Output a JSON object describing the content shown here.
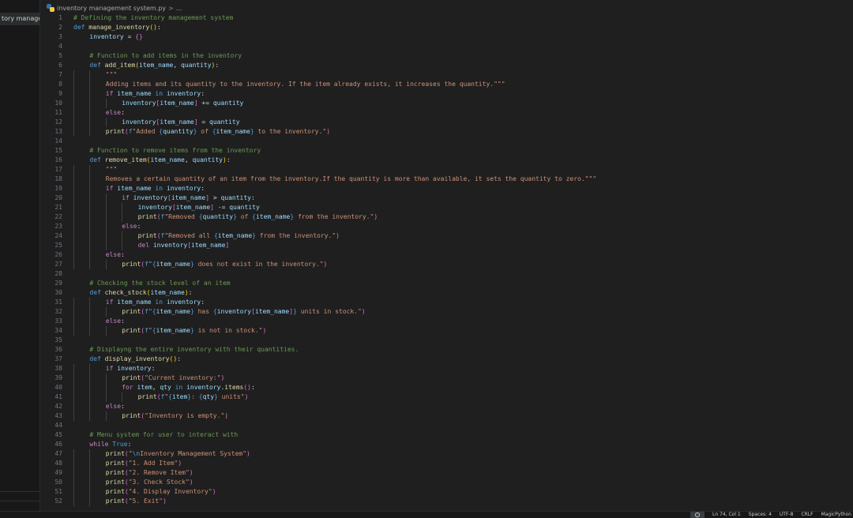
{
  "explorer": {
    "open_item": "tory manage..."
  },
  "tab": {
    "file_name": "inventory management system.py",
    "chevron": ">",
    "ellipsis": "..."
  },
  "status_bar": {
    "line_col": "Ln 74, Col 1",
    "spaces": "Spaces: 4",
    "encoding": "UTF-8",
    "eol": "CRLF",
    "language": "MagicPython"
  },
  "code": [
    {
      "n": "1",
      "i": 0,
      "t": [
        [
          "cm",
          "# Defining the inventory management system"
        ]
      ]
    },
    {
      "n": "2",
      "i": 0,
      "t": [
        [
          "kw",
          "def "
        ],
        [
          "fn",
          "manage_inventory"
        ],
        [
          "br",
          "()"
        ],
        [
          "op",
          ":"
        ]
      ]
    },
    {
      "n": "3",
      "i": 1,
      "t": [
        [
          "var",
          "inventory"
        ],
        [
          "op",
          " = "
        ],
        [
          "br2",
          "{}"
        ]
      ]
    },
    {
      "n": "4",
      "i": 0,
      "t": []
    },
    {
      "n": "5",
      "i": 1,
      "t": [
        [
          "cm",
          "# Function to add items in the inventory"
        ]
      ]
    },
    {
      "n": "6",
      "i": 1,
      "t": [
        [
          "kw",
          "def "
        ],
        [
          "fn",
          "add_item"
        ],
        [
          "br",
          "("
        ],
        [
          "var",
          "item_name"
        ],
        [
          "op",
          ", "
        ],
        [
          "var",
          "quantity"
        ],
        [
          "br",
          ")"
        ],
        [
          "op",
          ":"
        ]
      ]
    },
    {
      "n": "7",
      "i": 2,
      "t": [
        [
          "str",
          "\"\"\""
        ]
      ]
    },
    {
      "n": "8",
      "i": 2,
      "t": [
        [
          "str",
          "Adding items and its quantity to the inventory. If the item already exists, it increases the quantity.\"\"\""
        ]
      ]
    },
    {
      "n": "9",
      "i": 2,
      "t": [
        [
          "ctl",
          "if "
        ],
        [
          "var",
          "item_name"
        ],
        [
          "kw",
          " in "
        ],
        [
          "var",
          "inventory"
        ],
        [
          "op",
          ":"
        ]
      ]
    },
    {
      "n": "10",
      "i": 3,
      "t": [
        [
          "var",
          "inventory"
        ],
        [
          "br2",
          "["
        ],
        [
          "var",
          "item_name"
        ],
        [
          "br2",
          "]"
        ],
        [
          "op",
          " += "
        ],
        [
          "var",
          "quantity"
        ]
      ]
    },
    {
      "n": "11",
      "i": 2,
      "t": [
        [
          "ctl",
          "else"
        ],
        [
          "op",
          ":"
        ]
      ]
    },
    {
      "n": "12",
      "i": 3,
      "t": [
        [
          "var",
          "inventory"
        ],
        [
          "br2",
          "["
        ],
        [
          "var",
          "item_name"
        ],
        [
          "br2",
          "]"
        ],
        [
          "op",
          " = "
        ],
        [
          "var",
          "quantity"
        ]
      ]
    },
    {
      "n": "13",
      "i": 2,
      "t": [
        [
          "fn",
          "print"
        ],
        [
          "br2",
          "("
        ],
        [
          "kw",
          "f"
        ],
        [
          "str",
          "\"Added "
        ],
        [
          "kw",
          "{"
        ],
        [
          "var",
          "quantity"
        ],
        [
          "kw",
          "}"
        ],
        [
          "str",
          " of "
        ],
        [
          "kw",
          "{"
        ],
        [
          "var",
          "item_name"
        ],
        [
          "kw",
          "}"
        ],
        [
          "str",
          " to the inventory.\""
        ],
        [
          "br2",
          ")"
        ]
      ]
    },
    {
      "n": "14",
      "i": 0,
      "t": []
    },
    {
      "n": "15",
      "i": 1,
      "t": [
        [
          "cm",
          "# Function to remove items from the inventory"
        ]
      ]
    },
    {
      "n": "16",
      "i": 1,
      "t": [
        [
          "kw",
          "def "
        ],
        [
          "fn",
          "remove_item"
        ],
        [
          "br",
          "("
        ],
        [
          "var",
          "item_name"
        ],
        [
          "op",
          ", "
        ],
        [
          "var",
          "quantity"
        ],
        [
          "br",
          ")"
        ],
        [
          "op",
          ":"
        ]
      ]
    },
    {
      "n": "17",
      "i": 2,
      "t": [
        [
          "str",
          "\"\"\""
        ]
      ]
    },
    {
      "n": "18",
      "i": 2,
      "t": [
        [
          "str",
          "Removes a certain quantity of an item from the inventory.If the quantity is more than available, it sets the quantity to zero.\"\"\""
        ]
      ]
    },
    {
      "n": "19",
      "i": 2,
      "t": [
        [
          "ctl",
          "if "
        ],
        [
          "var",
          "item_name"
        ],
        [
          "kw",
          " in "
        ],
        [
          "var",
          "inventory"
        ],
        [
          "op",
          ":"
        ]
      ]
    },
    {
      "n": "20",
      "i": 3,
      "t": [
        [
          "ctl",
          "if "
        ],
        [
          "var",
          "inventory"
        ],
        [
          "br2",
          "["
        ],
        [
          "var",
          "item_name"
        ],
        [
          "br2",
          "]"
        ],
        [
          "op",
          " > "
        ],
        [
          "var",
          "quantity"
        ],
        [
          "op",
          ":"
        ]
      ]
    },
    {
      "n": "21",
      "i": 4,
      "t": [
        [
          "var",
          "inventory"
        ],
        [
          "br2",
          "["
        ],
        [
          "var",
          "item_name"
        ],
        [
          "br2",
          "]"
        ],
        [
          "op",
          " -= "
        ],
        [
          "var",
          "quantity"
        ]
      ]
    },
    {
      "n": "22",
      "i": 4,
      "t": [
        [
          "fn",
          "print"
        ],
        [
          "br2",
          "("
        ],
        [
          "kw",
          "f"
        ],
        [
          "str",
          "\"Removed "
        ],
        [
          "kw",
          "{"
        ],
        [
          "var",
          "quantity"
        ],
        [
          "kw",
          "}"
        ],
        [
          "str",
          " of "
        ],
        [
          "kw",
          "{"
        ],
        [
          "var",
          "item_name"
        ],
        [
          "kw",
          "}"
        ],
        [
          "str",
          " from the inventory.\""
        ],
        [
          "br2",
          ")"
        ]
      ]
    },
    {
      "n": "23",
      "i": 3,
      "t": [
        [
          "ctl",
          "else"
        ],
        [
          "op",
          ":"
        ]
      ]
    },
    {
      "n": "24",
      "i": 4,
      "t": [
        [
          "fn",
          "print"
        ],
        [
          "br2",
          "("
        ],
        [
          "kw",
          "f"
        ],
        [
          "str",
          "\"Removed all "
        ],
        [
          "kw",
          "{"
        ],
        [
          "var",
          "item_name"
        ],
        [
          "kw",
          "}"
        ],
        [
          "str",
          " from the inventory.\""
        ],
        [
          "br2",
          ")"
        ]
      ]
    },
    {
      "n": "25",
      "i": 4,
      "t": [
        [
          "ctl",
          "del "
        ],
        [
          "var",
          "inventory"
        ],
        [
          "br2",
          "["
        ],
        [
          "var",
          "item_name"
        ],
        [
          "br2",
          "]"
        ]
      ]
    },
    {
      "n": "26",
      "i": 2,
      "t": [
        [
          "ctl",
          "else"
        ],
        [
          "op",
          ":"
        ]
      ]
    },
    {
      "n": "27",
      "i": 3,
      "t": [
        [
          "fn",
          "print"
        ],
        [
          "br2",
          "("
        ],
        [
          "kw",
          "f"
        ],
        [
          "str",
          "\""
        ],
        [
          "kw",
          "{"
        ],
        [
          "var",
          "item_name"
        ],
        [
          "kw",
          "}"
        ],
        [
          "str",
          " does not exist in the inventory.\""
        ],
        [
          "br2",
          ")"
        ]
      ]
    },
    {
      "n": "28",
      "i": 0,
      "t": []
    },
    {
      "n": "29",
      "i": 1,
      "t": [
        [
          "cm",
          "# Checking the stock level of an item"
        ]
      ]
    },
    {
      "n": "30",
      "i": 1,
      "t": [
        [
          "kw",
          "def "
        ],
        [
          "fn",
          "check_stock"
        ],
        [
          "br",
          "("
        ],
        [
          "var",
          "item_name"
        ],
        [
          "br",
          ")"
        ],
        [
          "op",
          ":"
        ]
      ]
    },
    {
      "n": "31",
      "i": 2,
      "t": [
        [
          "ctl",
          "if "
        ],
        [
          "var",
          "item_name"
        ],
        [
          "kw",
          " in "
        ],
        [
          "var",
          "inventory"
        ],
        [
          "op",
          ":"
        ]
      ]
    },
    {
      "n": "32",
      "i": 3,
      "t": [
        [
          "fn",
          "print"
        ],
        [
          "br2",
          "("
        ],
        [
          "kw",
          "f"
        ],
        [
          "str",
          "\""
        ],
        [
          "kw",
          "{"
        ],
        [
          "var",
          "item_name"
        ],
        [
          "kw",
          "}"
        ],
        [
          "str",
          " has "
        ],
        [
          "kw",
          "{"
        ],
        [
          "var",
          "inventory"
        ],
        [
          "br2",
          "["
        ],
        [
          "var",
          "item_name"
        ],
        [
          "br2",
          "]"
        ],
        [
          "kw",
          "}"
        ],
        [
          "str",
          " units in stock.\""
        ],
        [
          "br2",
          ")"
        ]
      ]
    },
    {
      "n": "33",
      "i": 2,
      "t": [
        [
          "ctl",
          "else"
        ],
        [
          "op",
          ":"
        ]
      ]
    },
    {
      "n": "34",
      "i": 3,
      "t": [
        [
          "fn",
          "print"
        ],
        [
          "br2",
          "("
        ],
        [
          "kw",
          "f"
        ],
        [
          "str",
          "\""
        ],
        [
          "kw",
          "{"
        ],
        [
          "var",
          "item_name"
        ],
        [
          "kw",
          "}"
        ],
        [
          "str",
          " is not in stock.\""
        ],
        [
          "br2",
          ")"
        ]
      ]
    },
    {
      "n": "35",
      "i": 0,
      "t": []
    },
    {
      "n": "36",
      "i": 1,
      "t": [
        [
          "cm",
          "# Displayng the entire inventory with their quantities."
        ]
      ]
    },
    {
      "n": "37",
      "i": 1,
      "t": [
        [
          "kw",
          "def "
        ],
        [
          "fn",
          "display_inventory"
        ],
        [
          "br",
          "()"
        ],
        [
          "op",
          ":"
        ]
      ]
    },
    {
      "n": "38",
      "i": 2,
      "t": [
        [
          "ctl",
          "if "
        ],
        [
          "var",
          "inventory"
        ],
        [
          "op",
          ":"
        ]
      ]
    },
    {
      "n": "39",
      "i": 3,
      "t": [
        [
          "fn",
          "print"
        ],
        [
          "br2",
          "("
        ],
        [
          "str",
          "\"Current inventory:\""
        ],
        [
          "br2",
          ")"
        ]
      ]
    },
    {
      "n": "40",
      "i": 3,
      "t": [
        [
          "ctl",
          "for "
        ],
        [
          "var",
          "item"
        ],
        [
          "op",
          ", "
        ],
        [
          "var",
          "qty"
        ],
        [
          "kw",
          " in "
        ],
        [
          "var",
          "inventory"
        ],
        [
          "op",
          "."
        ],
        [
          "fn",
          "items"
        ],
        [
          "br2",
          "()"
        ],
        [
          "op",
          ":"
        ]
      ]
    },
    {
      "n": "41",
      "i": 4,
      "t": [
        [
          "fn",
          "print"
        ],
        [
          "br2",
          "("
        ],
        [
          "kw",
          "f"
        ],
        [
          "str",
          "\""
        ],
        [
          "kw",
          "{"
        ],
        [
          "var",
          "item"
        ],
        [
          "kw",
          "}"
        ],
        [
          "str",
          ": "
        ],
        [
          "kw",
          "{"
        ],
        [
          "var",
          "qty"
        ],
        [
          "kw",
          "}"
        ],
        [
          "str",
          " units\""
        ],
        [
          "br2",
          ")"
        ]
      ]
    },
    {
      "n": "42",
      "i": 2,
      "t": [
        [
          "ctl",
          "else"
        ],
        [
          "op",
          ":"
        ]
      ]
    },
    {
      "n": "43",
      "i": 3,
      "t": [
        [
          "fn",
          "print"
        ],
        [
          "br2",
          "("
        ],
        [
          "str",
          "\"Inventory is empty.\""
        ],
        [
          "br2",
          ")"
        ]
      ]
    },
    {
      "n": "44",
      "i": 0,
      "t": []
    },
    {
      "n": "45",
      "i": 1,
      "t": [
        [
          "cm",
          "# Menu system for user to interact with"
        ]
      ]
    },
    {
      "n": "46",
      "i": 1,
      "t": [
        [
          "ctl",
          "while "
        ],
        [
          "kw",
          "True"
        ],
        [
          "op",
          ":"
        ]
      ]
    },
    {
      "n": "47",
      "i": 2,
      "t": [
        [
          "fn",
          "print"
        ],
        [
          "br2",
          "("
        ],
        [
          "str",
          "\""
        ],
        [
          "kw",
          "\\n"
        ],
        [
          "str",
          "Inventory Management System\""
        ],
        [
          "br2",
          ")"
        ]
      ]
    },
    {
      "n": "48",
      "i": 2,
      "t": [
        [
          "fn",
          "print"
        ],
        [
          "br2",
          "("
        ],
        [
          "str",
          "\"1. Add Item\""
        ],
        [
          "br2",
          ")"
        ]
      ]
    },
    {
      "n": "49",
      "i": 2,
      "t": [
        [
          "fn",
          "print"
        ],
        [
          "br2",
          "("
        ],
        [
          "str",
          "\"2. Remove Item\""
        ],
        [
          "br2",
          ")"
        ]
      ]
    },
    {
      "n": "50",
      "i": 2,
      "t": [
        [
          "fn",
          "print"
        ],
        [
          "br2",
          "("
        ],
        [
          "str",
          "\"3. Check Stock\""
        ],
        [
          "br2",
          ")"
        ]
      ]
    },
    {
      "n": "51",
      "i": 2,
      "t": [
        [
          "fn",
          "print"
        ],
        [
          "br2",
          "("
        ],
        [
          "str",
          "\"4. Display Inventory\""
        ],
        [
          "br2",
          ")"
        ]
      ]
    },
    {
      "n": "52",
      "i": 2,
      "t": [
        [
          "fn",
          "print"
        ],
        [
          "br2",
          "("
        ],
        [
          "str",
          "\"5. Exit\""
        ],
        [
          "br2",
          ")"
        ]
      ]
    }
  ]
}
